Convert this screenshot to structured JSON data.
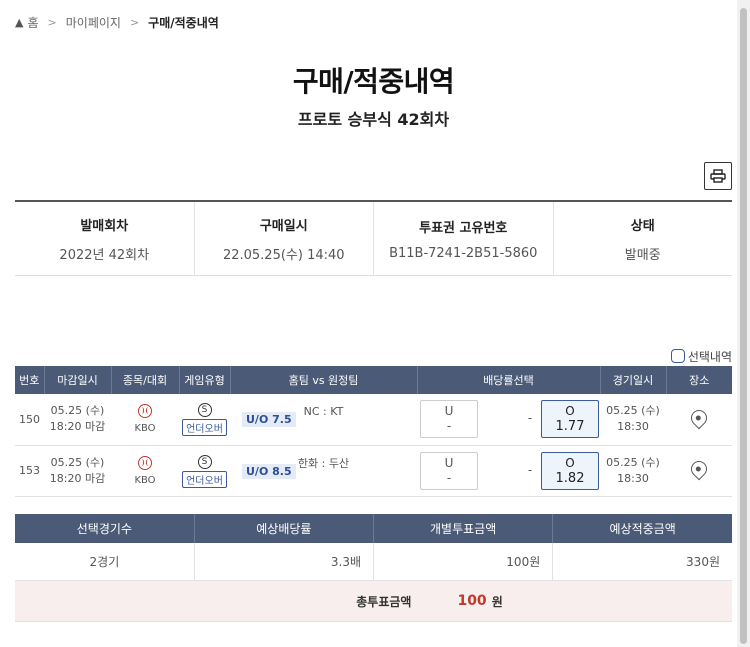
{
  "breadcrumb": {
    "home": "홈",
    "mypage": "마이페이지",
    "current": "구매/적중내역"
  },
  "page": {
    "title": "구매/적중내역",
    "subtitle": "프로토 승부식 42회차"
  },
  "info": {
    "headers": [
      "발매회차",
      "구매일시",
      "투표권 고유번호",
      "상태"
    ],
    "values": [
      "2022년 42회차",
      "22.05.25(수) 14:40",
      "B11B-7241-2B51-5860",
      "발매중"
    ]
  },
  "select_label": "선택내역",
  "games": {
    "headers": [
      "번호",
      "마감일시",
      "종목/대회",
      "게임유형",
      "홈팀 vs 원정팀",
      "배당률선택",
      "경기일시",
      "장소"
    ],
    "rows": [
      {
        "no": "150",
        "deadline_date": "05.25 (수)",
        "deadline_time": "18:20 마감",
        "league": "KBO",
        "type_icon": "S",
        "type": "언더오버",
        "teams": "NC : KT",
        "uo": "U/O 7.5",
        "u_label": "U",
        "u_val": "-",
        "draw": "-",
        "o_label": "O",
        "o_val": "1.77",
        "game_date": "05.25 (수)",
        "game_time": "18:30"
      },
      {
        "no": "153",
        "deadline_date": "05.25 (수)",
        "deadline_time": "18:20 마감",
        "league": "KBO",
        "type_icon": "S",
        "type": "언더오버",
        "teams": "한화 : 두산",
        "uo": "U/O 8.5",
        "u_label": "U",
        "u_val": "-",
        "draw": "-",
        "o_label": "O",
        "o_val": "1.82",
        "game_date": "05.25 (수)",
        "game_time": "18:30"
      }
    ]
  },
  "summary": {
    "headers": [
      "선택경기수",
      "예상배당률",
      "개별투표금액",
      "예상적중금액"
    ],
    "values": [
      "2경기",
      "3.3배",
      "100원",
      "330원"
    ]
  },
  "total": {
    "label": "총투표금액",
    "amount": "100",
    "unit": "원"
  },
  "colors": {
    "header_bg": "#4b5a77",
    "accent": "#3a5a9a",
    "total_bg": "#f8eeee",
    "amount": "#c0392b"
  }
}
